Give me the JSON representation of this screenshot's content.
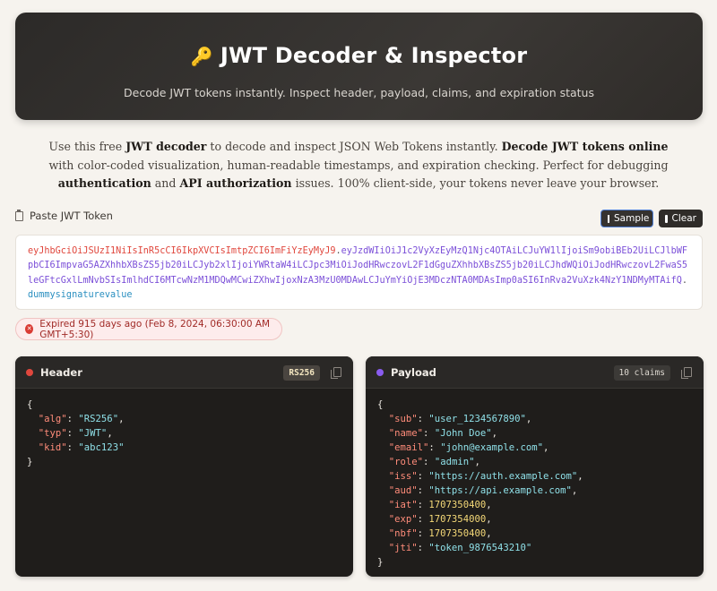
{
  "hero": {
    "title": "JWT Decoder & Inspector",
    "subtitle": "Decode JWT tokens instantly. Inspect header, payload, claims, and expiration status"
  },
  "intro": {
    "p1": "Use this free ",
    "b1": "JWT decoder",
    "p2": " to decode and inspect JSON Web Tokens instantly. ",
    "b2": "Decode JWT tokens online",
    "p3": " with color-coded visualization, human-readable timestamps, and expiration checking. Perfect for debugging ",
    "b3": "authentication",
    "p4": " and ",
    "b4": "API authorization",
    "p5": " issues. 100% client-side, your tokens never leave your browser."
  },
  "input": {
    "label": "Paste JWT Token",
    "sample_label": "Sample",
    "clear_label": "Clear"
  },
  "token": {
    "header": "eyJhbGciOiJSUzI1NiIsInR5cCI6IkpXVCIsImtpZCI6ImFiYzEyMyJ9",
    "payload": "eyJzdWIiOiJ1c2VyXzEyMzQ1Njc4OTAiLCJuYW1lIjoiSm9obiBEb2UiLCJlbWFpbCI6ImpvaG5AZXhhbXBsZS5jb20iLCJyb2xlIjoiYWRtaW4iLCJpc3MiOiJodHRwczovL2F1dGguZXhhbXBsZS5jb20iLCJhdWQiOiJodHRwczovL2FwaS5leGFtcGxlLmNvbSIsImlhdCI6MTcwNzM1MDQwMCwiZXhwIjoxNzA3MzU0MDAwLCJuYmYiOjE3MDczNTA0MDAsImp0aSI6InRva2VuXzk4NzY1NDMyMTAifQ",
    "signature": "dummysignaturevalue"
  },
  "status": {
    "text": "Expired 915 days ago (Feb 8, 2024, 06:30:00 AM GMT+5:30)",
    "color": "#d93a33"
  },
  "header_panel": {
    "title": "Header",
    "badge": "RS256",
    "fields": [
      {
        "key": "\"alg\"",
        "value": "\"RS256\""
      },
      {
        "key": "\"typ\"",
        "value": "\"JWT\""
      },
      {
        "key": "\"kid\"",
        "value": "\"abc123\""
      }
    ]
  },
  "payload_panel": {
    "title": "Payload",
    "badge": "10 claims",
    "fields": [
      {
        "key": "\"sub\"",
        "value": "\"user_1234567890\""
      },
      {
        "key": "\"name\"",
        "value": "\"John Doe\""
      },
      {
        "key": "\"email\"",
        "value": "\"john@example.com\""
      },
      {
        "key": "\"role\"",
        "value": "\"admin\""
      },
      {
        "key": "\"iss\"",
        "value": "\"https://auth.example.com\""
      },
      {
        "key": "\"aud\"",
        "value": "\"https://api.example.com\""
      },
      {
        "key": "\"iat\"",
        "value": "1707350400"
      },
      {
        "key": "\"exp\"",
        "value": "1707354000"
      },
      {
        "key": "\"nbf\"",
        "value": "1707350400"
      },
      {
        "key": "\"jti\"",
        "value": "\"token_9876543210\""
      }
    ]
  },
  "colors": {
    "header_dot": "#e0473d",
    "payload_dot": "#8a5cf0",
    "signature": "#2a8fc0"
  }
}
